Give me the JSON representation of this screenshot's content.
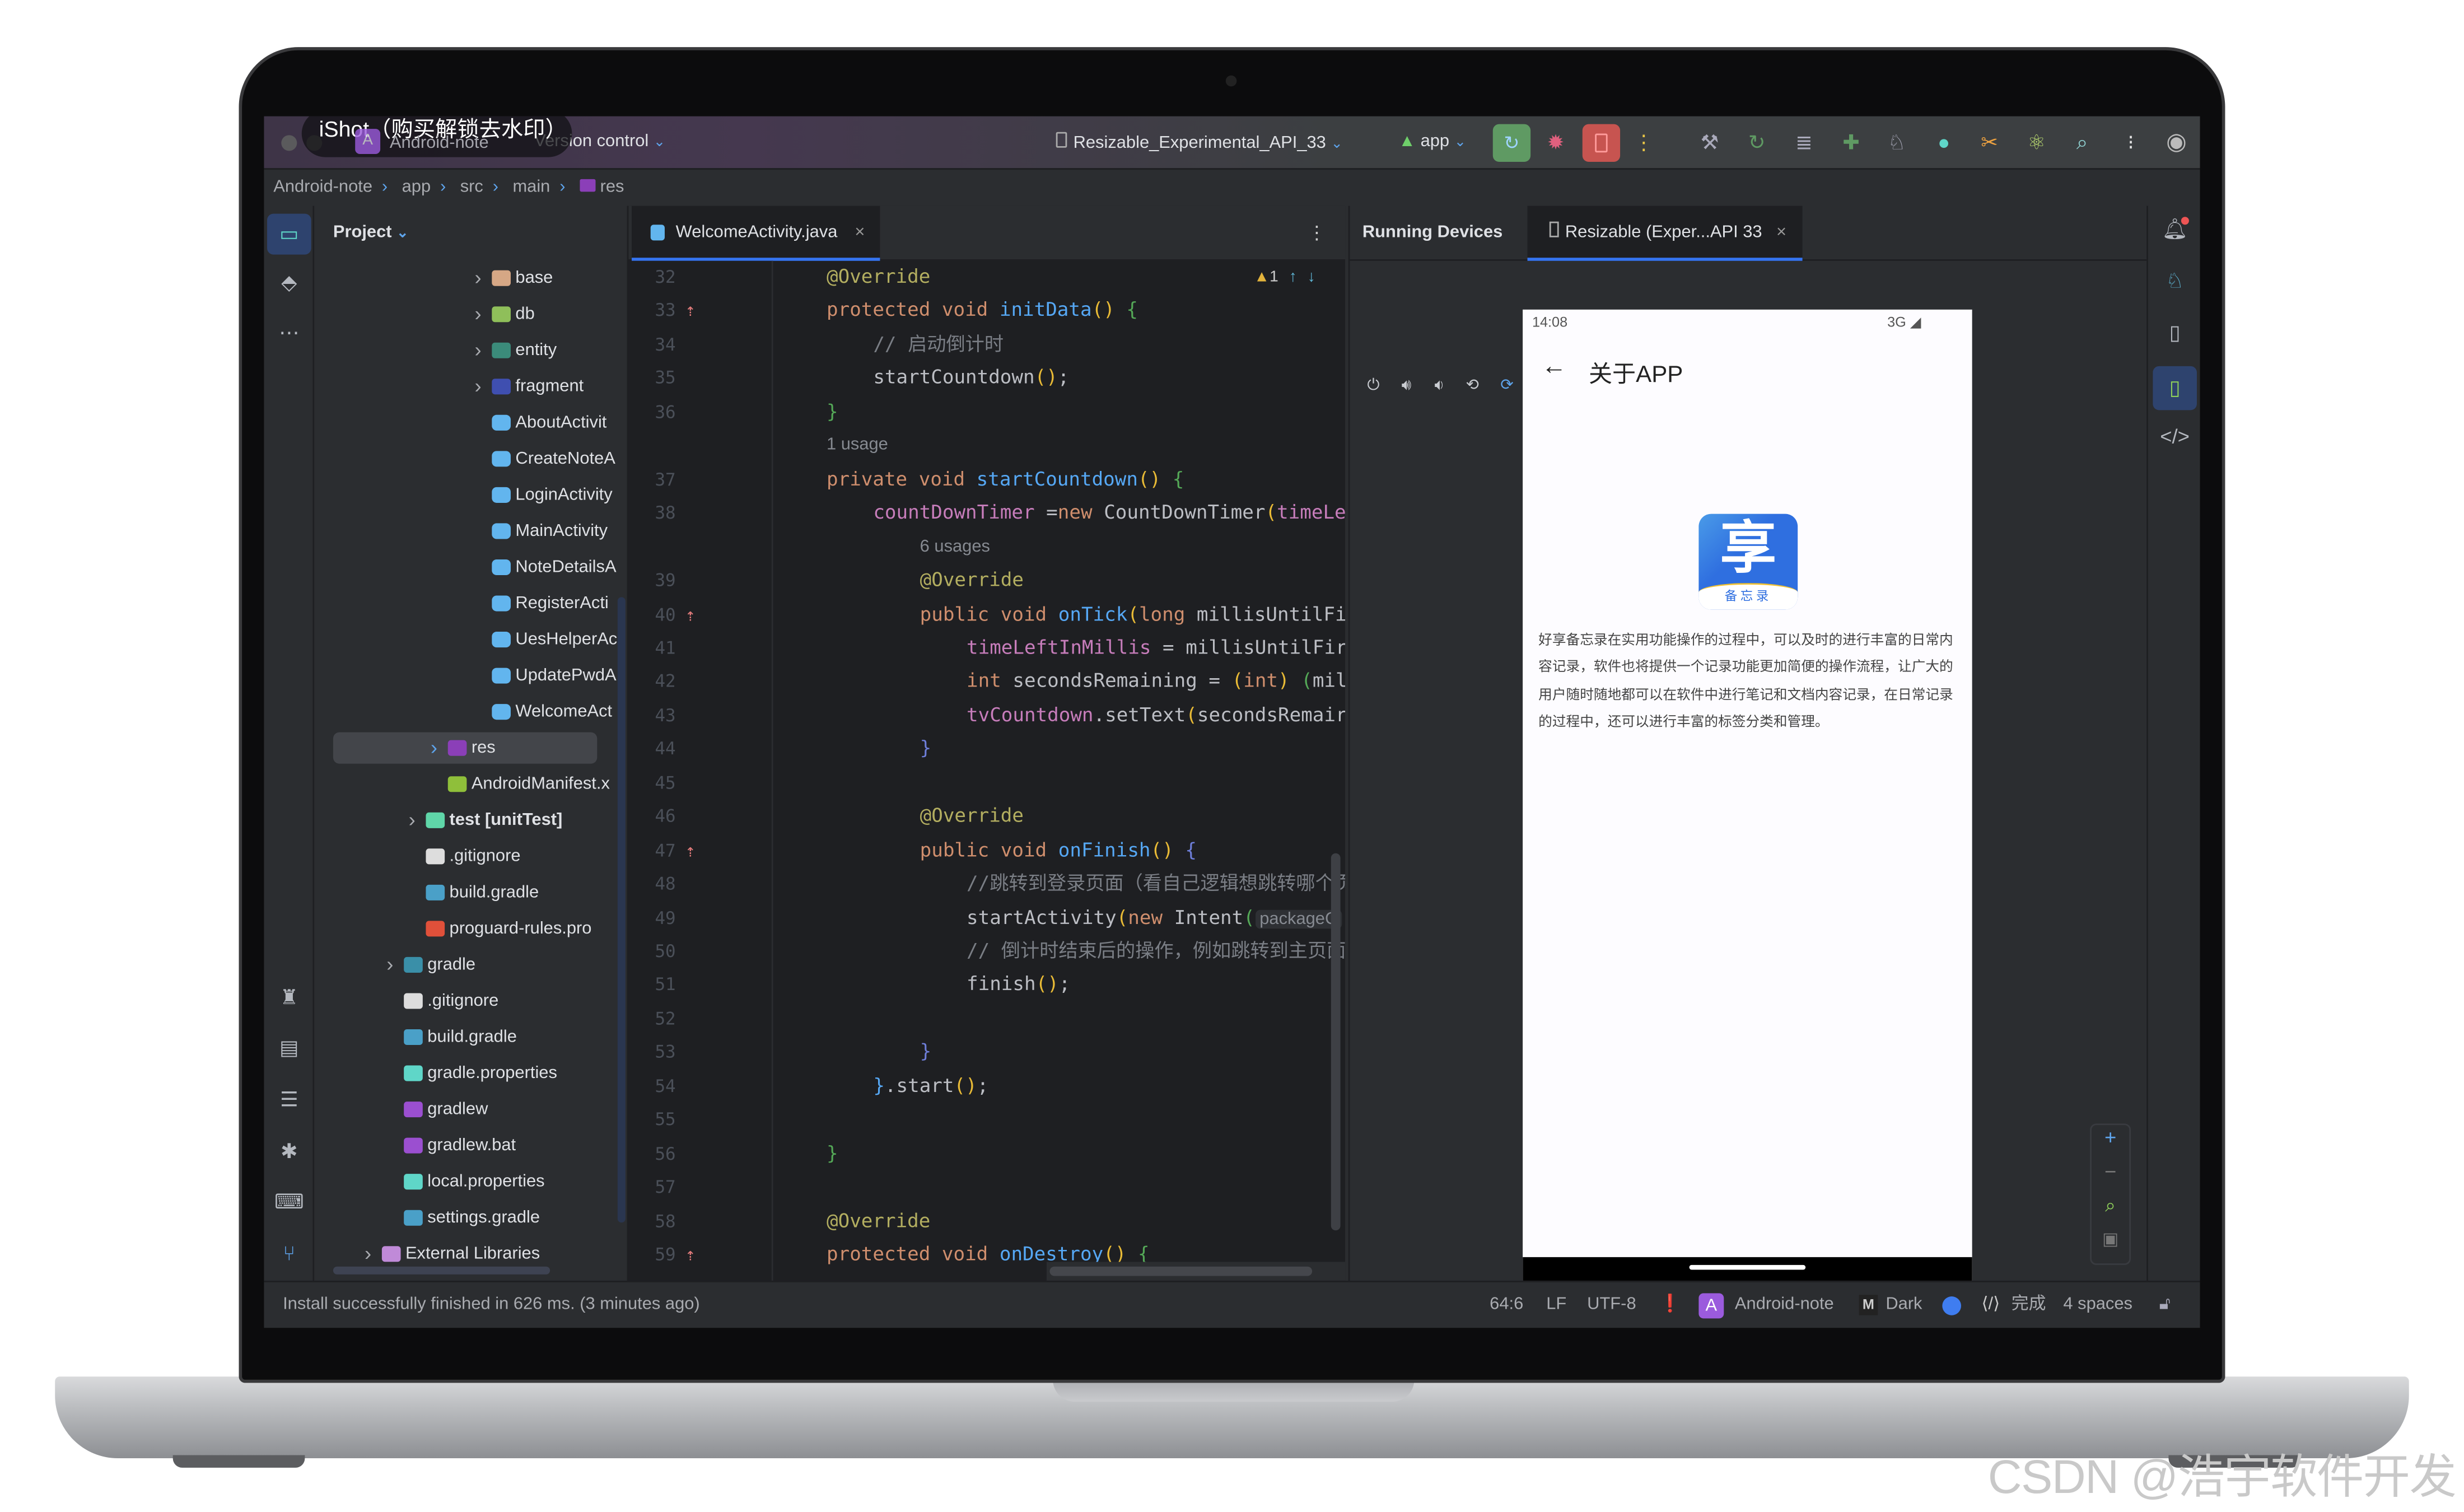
{
  "titlebar": {
    "watermark": "iShot（购买解锁去水印）",
    "project_badge": "A",
    "project": "Android-note",
    "vcs": "Version control",
    "device": "Resizable_Experimental_API_33",
    "run_config": "app"
  },
  "breadcrumb": [
    "Android-note",
    "app",
    "src",
    "main",
    "res"
  ],
  "project_panel": {
    "title": "Project",
    "items": [
      {
        "label": "base",
        "depth": 6,
        "kind": "folder",
        "color": "#d6a785",
        "expand": true
      },
      {
        "label": "db",
        "depth": 6,
        "kind": "folder",
        "color": "#8fbf5a",
        "expand": true
      },
      {
        "label": "entity",
        "depth": 6,
        "kind": "folder",
        "color": "#3b8b7a",
        "expand": true
      },
      {
        "label": "fragment",
        "depth": 6,
        "kind": "folder",
        "color": "#3f4fb0",
        "expand": true
      },
      {
        "label": "AboutActivit",
        "depth": 6,
        "kind": "class"
      },
      {
        "label": "CreateNoteA",
        "depth": 6,
        "kind": "class"
      },
      {
        "label": "LoginActivity",
        "depth": 6,
        "kind": "class"
      },
      {
        "label": "MainActivity",
        "depth": 6,
        "kind": "class"
      },
      {
        "label": "NoteDetailsA",
        "depth": 6,
        "kind": "class"
      },
      {
        "label": "RegisterActi",
        "depth": 6,
        "kind": "class"
      },
      {
        "label": "UesHelperAc",
        "depth": 6,
        "kind": "class"
      },
      {
        "label": "UpdatePwdA",
        "depth": 6,
        "kind": "class"
      },
      {
        "label": "WelcomeAct",
        "depth": 6,
        "kind": "class"
      },
      {
        "label": "res",
        "depth": 4,
        "kind": "folder",
        "color": "#8b3fb8",
        "expand": true,
        "selected": true
      },
      {
        "label": "AndroidManifest.x",
        "depth": 4,
        "kind": "android"
      },
      {
        "label": "test [unitTest]",
        "depth": 3,
        "kind": "folder",
        "color": "#5fd6a8",
        "expand": true,
        "bold": true
      },
      {
        "label": ".gitignore",
        "depth": 3,
        "kind": "git"
      },
      {
        "label": "build.gradle",
        "depth": 3,
        "kind": "gradle"
      },
      {
        "label": "proguard-rules.pro",
        "depth": 3,
        "kind": "proguard"
      },
      {
        "label": "gradle",
        "depth": 2,
        "kind": "folder",
        "color": "#3a8fa8",
        "expand": true
      },
      {
        "label": ".gitignore",
        "depth": 2,
        "kind": "git"
      },
      {
        "label": "build.gradle",
        "depth": 2,
        "kind": "gradle"
      },
      {
        "label": "gradle.properties",
        "depth": 2,
        "kind": "props"
      },
      {
        "label": "gradlew",
        "depth": 2,
        "kind": "gradlew"
      },
      {
        "label": "gradlew.bat",
        "depth": 2,
        "kind": "gradlew"
      },
      {
        "label": "local.properties",
        "depth": 2,
        "kind": "props"
      },
      {
        "label": "settings.gradle",
        "depth": 2,
        "kind": "gradle"
      },
      {
        "label": "External Libraries",
        "depth": 1,
        "kind": "folder",
        "color": "#c08ad8",
        "expand": true
      }
    ]
  },
  "editor": {
    "tab": "WelcomeActivity.java",
    "warnings": "1",
    "lines": [
      {
        "n": "32",
        "i": 1,
        "tok": [
          [
            "a",
            "@Override"
          ]
        ]
      },
      {
        "n": "33",
        "i": 1,
        "g": true,
        "tok": [
          [
            "k",
            "protected void "
          ],
          [
            "f",
            "initData"
          ],
          [
            "b1",
            "()"
          ],
          [
            "t",
            " "
          ],
          [
            "b2",
            "{"
          ]
        ]
      },
      {
        "n": "34",
        "i": 2,
        "tok": [
          [
            "c",
            "// 启动倒计时"
          ]
        ]
      },
      {
        "n": "35",
        "i": 2,
        "tok": [
          [
            "t",
            "startCountdown"
          ],
          [
            "b1",
            "()"
          ],
          [
            "t",
            ";"
          ]
        ]
      },
      {
        "n": "36",
        "i": 1,
        "tok": [
          [
            "b2",
            "}"
          ]
        ]
      },
      {
        "hint": "1 usage",
        "i": 1
      },
      {
        "n": "37",
        "i": 1,
        "tok": [
          [
            "k",
            "private void "
          ],
          [
            "f",
            "startCountdown"
          ],
          [
            "b1",
            "()"
          ],
          [
            "t",
            " "
          ],
          [
            "b2",
            "{"
          ]
        ]
      },
      {
        "n": "38",
        "i": 2,
        "tok": [
          [
            "p",
            "countDownTimer"
          ],
          [
            "t",
            " ="
          ],
          [
            "k",
            "new "
          ],
          [
            "t",
            "CountDownTimer"
          ],
          [
            "b1",
            "("
          ],
          [
            "p",
            "timeLe"
          ]
        ]
      },
      {
        "hint": "6 usages",
        "i": 3
      },
      {
        "n": "39",
        "i": 3,
        "tok": [
          [
            "a",
            "@Override"
          ]
        ]
      },
      {
        "n": "40",
        "i": 3,
        "g": true,
        "tok": [
          [
            "k",
            "public void "
          ],
          [
            "f",
            "onTick"
          ],
          [
            "b1",
            "("
          ],
          [
            "k",
            "long "
          ],
          [
            "t",
            "millisUntilFi"
          ]
        ]
      },
      {
        "n": "41",
        "i": 4,
        "tok": [
          [
            "p",
            "timeLeftInMillis"
          ],
          [
            "t",
            " = millisUntilFir"
          ]
        ]
      },
      {
        "n": "42",
        "i": 4,
        "tok": [
          [
            "k",
            "int "
          ],
          [
            "t",
            "secondsRemaining = "
          ],
          [
            "b1",
            "("
          ],
          [
            "k",
            "int"
          ],
          [
            "b1",
            ")"
          ],
          [
            "t",
            " "
          ],
          [
            "b2",
            "("
          ],
          [
            "t",
            "mil"
          ]
        ]
      },
      {
        "n": "43",
        "i": 4,
        "tok": [
          [
            "p",
            "tvCountdown"
          ],
          [
            "t",
            ".setText"
          ],
          [
            "b1",
            "("
          ],
          [
            "t",
            "secondsRemair"
          ]
        ]
      },
      {
        "n": "44",
        "i": 3,
        "tok": [
          [
            "b3",
            "}"
          ]
        ]
      },
      {
        "n": "45",
        "i": 0,
        "tok": []
      },
      {
        "n": "46",
        "i": 3,
        "tok": [
          [
            "a",
            "@Override"
          ]
        ]
      },
      {
        "n": "47",
        "i": 3,
        "g": true,
        "tok": [
          [
            "k",
            "public void "
          ],
          [
            "f",
            "onFinish"
          ],
          [
            "b1",
            "()"
          ],
          [
            "t",
            " "
          ],
          [
            "b3",
            "{"
          ]
        ]
      },
      {
        "n": "48",
        "i": 4,
        "tok": [
          [
            "c",
            "//跳转到登录页面（看自己逻辑想跳转哪个页"
          ]
        ]
      },
      {
        "n": "49",
        "i": 4,
        "tok": [
          [
            "t",
            "startActivity"
          ],
          [
            "b1",
            "("
          ],
          [
            "k",
            "new "
          ],
          [
            "t",
            "Intent"
          ],
          [
            "b2",
            "("
          ],
          [
            "inl",
            "packageC"
          ]
        ]
      },
      {
        "n": "50",
        "i": 4,
        "tok": [
          [
            "c",
            "// 倒计时结束后的操作，例如跳转到主页面"
          ]
        ]
      },
      {
        "n": "51",
        "i": 4,
        "tok": [
          [
            "t",
            "finish"
          ],
          [
            "b1",
            "()"
          ],
          [
            "t",
            ";"
          ]
        ]
      },
      {
        "n": "52",
        "i": 0,
        "tok": []
      },
      {
        "n": "53",
        "i": 3,
        "tok": [
          [
            "b3",
            "}"
          ]
        ]
      },
      {
        "n": "54",
        "i": 2,
        "tok": [
          [
            "f",
            "}"
          ],
          [
            "t",
            ".start"
          ],
          [
            "b1",
            "()"
          ],
          [
            "t",
            ";"
          ]
        ]
      },
      {
        "n": "55",
        "i": 0,
        "tok": []
      },
      {
        "n": "56",
        "i": 1,
        "tok": [
          [
            "b2",
            "}"
          ]
        ]
      },
      {
        "n": "57",
        "i": 0,
        "tok": []
      },
      {
        "n": "58",
        "i": 1,
        "tok": [
          [
            "a",
            "@Override"
          ]
        ]
      },
      {
        "n": "59",
        "i": 1,
        "g": true,
        "tok": [
          [
            "k",
            "protected void "
          ],
          [
            "f",
            "onDestroy"
          ],
          [
            "b1",
            "()"
          ],
          [
            "t",
            " "
          ],
          [
            "b2",
            "{"
          ]
        ]
      }
    ]
  },
  "devices": {
    "panel_title": "Running Devices",
    "device_tab": "Resizable (Exper...API 33"
  },
  "phone": {
    "time": "14:08",
    "network": "3G",
    "title": "关于APP",
    "logo_char": "享",
    "logo_caption": "备忘录",
    "description": "好享备忘录在实用功能操作的过程中，可以及时的进行丰富的日常内容记录，软件也将提供一个记录功能更加简便的操作流程，让广大的用户随时随地都可以在软件中进行笔记和文档内容记录，在日常记录的过程中，还可以进行丰富的标签分类和管理。"
  },
  "statusbar": {
    "message": "Install successfully finished in 626 ms. (3 minutes ago)",
    "position": "64:6",
    "line_sep": "LF",
    "encoding": "UTF-8",
    "project_badge": "A",
    "project": "Android-note",
    "theme_badge": "M",
    "theme": "Dark",
    "ai_status": "完成",
    "indent": "4 spaces"
  },
  "watermark": "CSDN @浩宇软件开发",
  "colors": {
    "accent": "#3574f0",
    "run": "#5f9a63",
    "stop": "#c75450",
    "project_badge": "#9b5bdd",
    "logo_blue": "#2f6fe0"
  }
}
